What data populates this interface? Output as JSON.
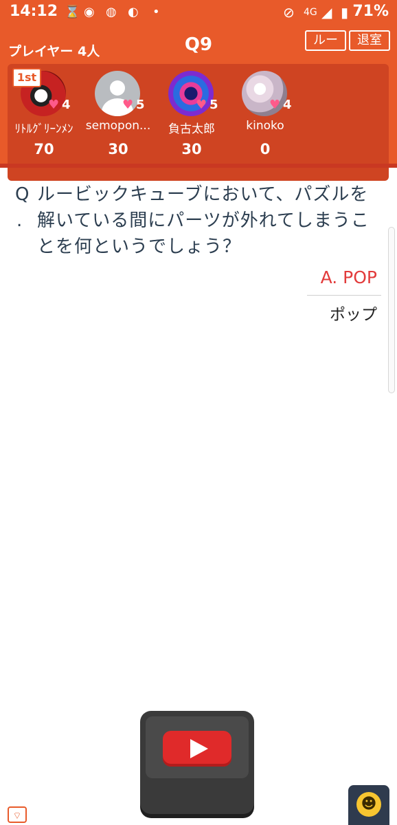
{
  "status_bar": {
    "time": "14:12",
    "network": "4G",
    "battery": "71%",
    "icons": [
      "hourglass-icon",
      "accessibility-icon",
      "globe-icon",
      "app-icon",
      "dot-icon",
      "mute-icon",
      "signal-icon",
      "battery-icon"
    ]
  },
  "header": {
    "players_label": "プレイヤー 4人",
    "question_no": "Q9",
    "rule_button": "ルー",
    "leave_button": "退室"
  },
  "players": [
    {
      "name": "ﾘﾄﾙｸﾞﾘｰﾝﾒﾝ",
      "lives": "4",
      "score": "70",
      "rank": "1st"
    },
    {
      "name": "semopon...",
      "lives": "5",
      "score": "30"
    },
    {
      "name": "負古太郎",
      "lives": "5",
      "score": "30"
    },
    {
      "name": "kinoko",
      "lives": "4",
      "score": "0"
    }
  ],
  "question": {
    "prefix": "Q",
    "dot": ".",
    "text": "ルービックキューブにおいて、パズルを解いている間にパーツが外れてしまうことを何というでしょう？",
    "answer": "A. POP",
    "reading": "ポップ"
  },
  "colors": {
    "header_bg": "#e85a2a",
    "panel_bg": "#cf4422",
    "answer": "#e23b3b",
    "heart": "#ff5a8a"
  }
}
